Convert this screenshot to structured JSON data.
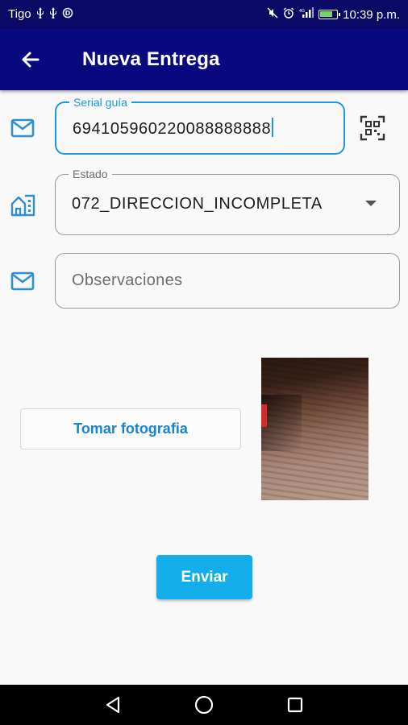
{
  "status_bar": {
    "carrier": "Tigo",
    "time": "10:39 p.m.",
    "left_icons": [
      "usb-icon",
      "usb-icon",
      "data-saver-icon"
    ],
    "right_icons": [
      "mute-icon",
      "alarm-icon",
      "signal-icon",
      "battery-icon"
    ],
    "battery_level": 0.8
  },
  "app_bar": {
    "title": "Nueva Entrega",
    "background": "#0a0a80"
  },
  "form": {
    "serial": {
      "label": "Serial guía",
      "value": "694105960220088888888",
      "icon": "mail-icon"
    },
    "estado": {
      "label": "Estado",
      "value": "072_DIRECCION_INCOMPLETA",
      "icon": "home-building-icon"
    },
    "observaciones": {
      "placeholder": "Observaciones",
      "icon": "mail-icon"
    },
    "accent_color": "#1a97e6"
  },
  "photo_section": {
    "button_label": "Tomar fotografia"
  },
  "actions": {
    "send_label": "Enviar",
    "send_color": "#13aee9"
  },
  "nav_bar": {
    "buttons": [
      "back-triangle-icon",
      "home-circle-icon",
      "recents-square-icon"
    ]
  }
}
